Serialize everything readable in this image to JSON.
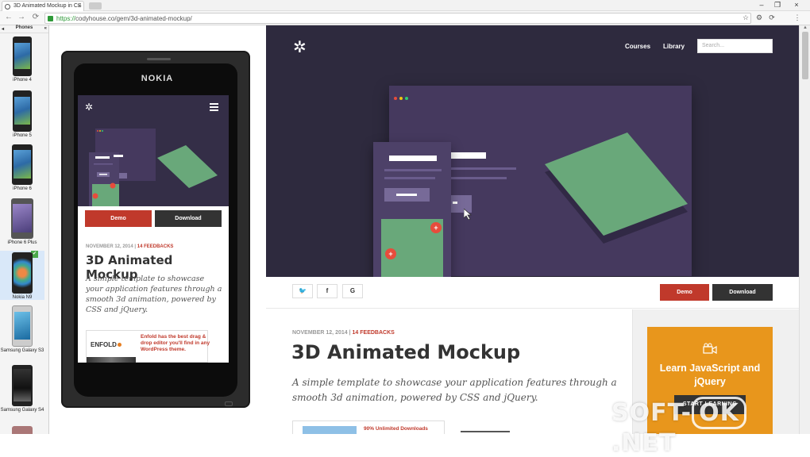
{
  "browser": {
    "tab_title": "3D Animated Mockup in CS",
    "tab_close": "×",
    "url_scheme": "https://",
    "url_rest": "codyhouse.co/gem/3d-animated-mockup/",
    "win_min": "–",
    "win_max": "❐",
    "win_close": "×",
    "nav_back": "←",
    "nav_forward": "→",
    "nav_reload": "⟳",
    "icon_star": "☆",
    "icon_gear": "⚙",
    "icon_sync": "⟳",
    "icon_menu": "⋮"
  },
  "sidebar": {
    "header": "Phones",
    "collapse_left": "◂",
    "collapse_right": "«",
    "devices": [
      {
        "label": "iPhone 4"
      },
      {
        "label": "iPhone 5"
      },
      {
        "label": "iPhone 6"
      },
      {
        "label": "iPhone 6 Plus"
      },
      {
        "label": "Nokia N9",
        "badge": "✔"
      },
      {
        "label": "Samsung Galaxy S3"
      },
      {
        "label": "Samsung Galaxy S4"
      }
    ],
    "scroll_up": "▲"
  },
  "nokia": {
    "brand": "NOKIA",
    "logo": "✲",
    "demo": "Demo",
    "download": "Download",
    "date": "NOVEMBER 12, 2014",
    "sep": "|",
    "feedbacks": "14 FEEDBACKS",
    "title": "3D Animated Mockup",
    "desc": "A simple template to showcase your application features through a smooth 3d animation, powered by CSS and jQuery.",
    "ad_brand": "ENFOLD",
    "ad_text": "Enfold has the best drag & drop editor you'll find in any WordPress theme."
  },
  "site": {
    "logo": "✲",
    "nav": [
      "Courses",
      "Library"
    ],
    "search_placeholder": "Search...",
    "share": [
      "🐦",
      "f",
      "G"
    ],
    "demo": "Demo",
    "download": "Download",
    "date": "NOVEMBER 12, 2014",
    "sep": "|",
    "feedbacks": "14 FEEDBACKS",
    "title": "3D Animated Mockup",
    "desc": "A simple template to showcase your application features through a smooth 3d animation, powered by CSS and jQuery.",
    "ad_text": "90% Unlimited Downloads",
    "plus": "+",
    "promo_title": "Learn JavaScript and jQuery",
    "promo_button": "START LEARNING"
  },
  "watermark": {
    "left": "SOFT-",
    "ring": "OK",
    "right": ".NET"
  },
  "colors": {
    "hero_bg": "#2e2a3e",
    "demo_red": "#c0392b",
    "download_dark": "#333333",
    "promo_orange": "#e8961c",
    "accent_green": "#69a87a"
  }
}
